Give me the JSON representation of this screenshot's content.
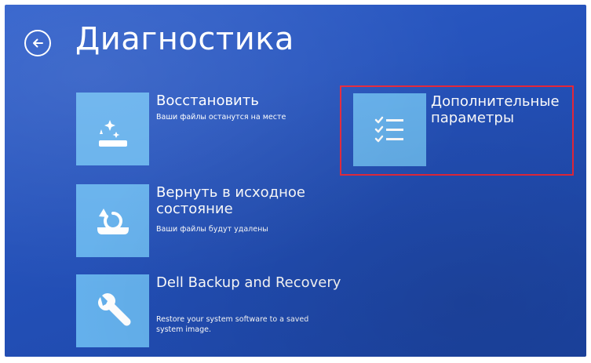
{
  "screen": {
    "title": "Диагностика",
    "background_color": "#2451b9",
    "tile_color": "#64b0ec",
    "highlight_color": "#e8273a"
  },
  "options": {
    "restore": {
      "title": "Восстановить",
      "description": "Ваши файлы останутся на месте",
      "icon": "restore-icon"
    },
    "reset": {
      "title": "Вернуть в исходное состояние",
      "description": "Ваши файлы будут удалены",
      "icon": "reset-icon"
    },
    "dell": {
      "title": "Dell Backup and Recovery",
      "description": "Restore your system software to a saved system image.",
      "icon": "wrench-icon"
    },
    "advanced": {
      "title": "Дополнительные параметры",
      "icon": "checklist-icon"
    }
  }
}
